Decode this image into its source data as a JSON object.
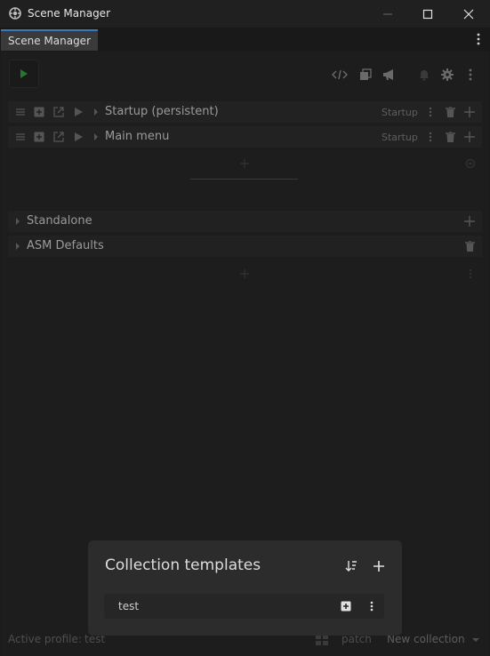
{
  "window": {
    "title": "Scene Manager"
  },
  "tab": {
    "label": "Scene Manager"
  },
  "toolbar": {
    "icons": [
      "code-icon",
      "layers-icon",
      "megaphone-icon",
      "bell-icon",
      "gear-icon",
      "more-icon"
    ]
  },
  "collections": [
    {
      "name": "Startup (persistent)",
      "tag": "Startup"
    },
    {
      "name": "Main menu",
      "tag": "Startup"
    }
  ],
  "groups": [
    {
      "name": "Standalone"
    },
    {
      "name": "ASM Defaults"
    }
  ],
  "popup": {
    "title": "Collection templates",
    "items": [
      {
        "name": "test"
      }
    ]
  },
  "status": {
    "profile_label": "Active profile:",
    "profile_value": "test",
    "patch_label": "patch",
    "new_collection_label": "New collection"
  },
  "colors": {
    "accent": "#3a79bb",
    "play": "#1f7a2e",
    "background": "#1d1d1d"
  }
}
